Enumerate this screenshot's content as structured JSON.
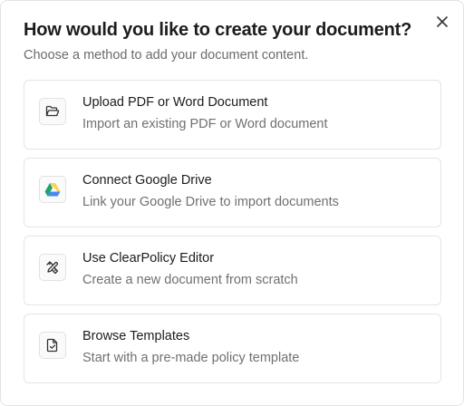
{
  "dialog": {
    "title": "How would you like to create your document?",
    "subtitle": "Choose a method to add your document content.",
    "close_icon": "close-icon"
  },
  "options": [
    {
      "icon": "folder-open-icon",
      "title": "Upload PDF or Word Document",
      "description": "Import an existing PDF or Word document"
    },
    {
      "icon": "google-drive-icon",
      "title": "Connect Google Drive",
      "description": "Link your Google Drive to import documents"
    },
    {
      "icon": "pencil-ruler-icon",
      "title": "Use ClearPolicy Editor",
      "description": "Create a new document from scratch"
    },
    {
      "icon": "file-check-icon",
      "title": "Browse Templates",
      "description": "Start with a pre-made policy template"
    }
  ],
  "colors": {
    "drive_green": "#1fa463",
    "drive_yellow": "#ffd04b",
    "drive_blue": "#4688f4"
  }
}
